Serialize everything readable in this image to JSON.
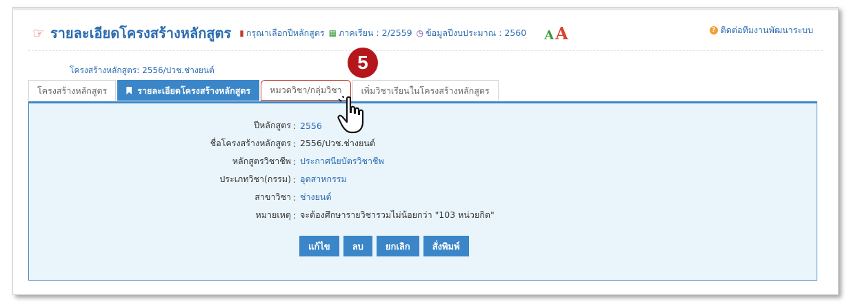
{
  "header": {
    "title": "รายละเอียดโครงสร้างหลักสูตร",
    "select_year": "กรุณาเลือกปีหลักสูตร",
    "semester": "ภาคเรียน : 2/2559",
    "budget_year": "ข้อมูลปีงบประมาณ : 2560",
    "font_small": "A",
    "font_large": "A",
    "contact": "ติดต่อทีมงานพัฒนาระบบ"
  },
  "breadcrumb": "โครงสร้างหลักสูตร: 2556/ปวช.ช่างยนต์",
  "tabs": [
    {
      "label": "โครงสร้างหลักสูตร"
    },
    {
      "label": "รายละเอียดโครงสร้างหลักสูตร"
    },
    {
      "label": "หมวดวิชา/กลุ่มวิชา"
    },
    {
      "label": "เพิ่มวิชาเรียนในโครงสร้างหลักสูตร"
    }
  ],
  "details": [
    {
      "label": "ปีหลักสูตร",
      "value": "2556"
    },
    {
      "label": "ชื่อโครงสร้างหลักสูตร",
      "value": "2556/ปวช.ช่างยนต์"
    },
    {
      "label": "หลักสูตรวิชาชีพ",
      "value": "ประกาศนียบัตรวิชาชีพ"
    },
    {
      "label": "ประเภทวิชา(กรรม)",
      "value": "อุตสาหกรรม"
    },
    {
      "label": "สาขาวิชา",
      "value": "ช่างยนต์"
    },
    {
      "label": "หมายเหตุ",
      "value": "จะต้องศึกษารายวิชารวมไม่น้อยกว่า \"103 หน่วยกิต\""
    }
  ],
  "colon": ":",
  "buttons": {
    "edit": "แก้ไข",
    "delete": "ลบ",
    "cancel": "ยกเลิก",
    "print": "สั่งพิมพ์"
  },
  "annotation": {
    "step": "5"
  },
  "colors": {
    "primary": "#3a86c8",
    "link": "#2a6cb0",
    "badge": "#b5161b",
    "panel_bg": "#e9f4fb"
  }
}
